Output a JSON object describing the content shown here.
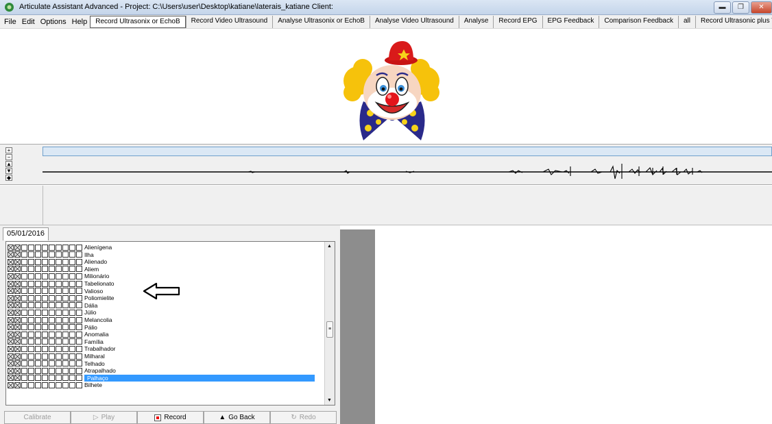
{
  "window": {
    "title": "Articulate Assistant Advanced -     Project: C:\\Users\\user\\Desktop\\katiane\\laterais_katiane     Client:",
    "controls": [
      "minimize",
      "maximize",
      "close"
    ]
  },
  "menubar": {
    "menus": [
      "File",
      "Edit",
      "Options",
      "Help"
    ],
    "tabs": [
      "Record Ultrasonix or EchoB",
      "Record Video Ultrasound",
      "Analyse Ultrasonix or EchoB",
      "Analyse Video Ultrasound",
      "Analyse",
      "Record EPG",
      "EPG Feedback",
      "Comparison Feedback",
      "all",
      "Record Ultrasonic plus Video"
    ],
    "active_tab": "Record Ultrasonix or EchoB",
    "tab_nav": "◂"
  },
  "zoom_controls": [
    "+",
    "−",
    "▲",
    "▼",
    "◆"
  ],
  "session": {
    "date_tab": "05/01/2016"
  },
  "word_list": {
    "words": [
      "Alienígena",
      "Ilha",
      "Alienado",
      "Aliem",
      "Milionário",
      "Tabelionato",
      "Valioso",
      "Poliomielite",
      "Dália",
      "Júlio",
      "Melancolia",
      "Pálio",
      "Anomalia",
      "Família",
      "Trabalhador",
      "Milharal",
      "Telhado",
      "Atrapalhado",
      "Palhaço",
      "Bilhete"
    ],
    "selected": "Palhaço",
    "scroll_thumb": "≡"
  },
  "buttons": {
    "calibrate": "Calibrate",
    "play": "Play",
    "record": "Record",
    "go_back": "Go Back",
    "redo": "Redo"
  },
  "colors": {
    "selection": "#3399ff",
    "record_dot": "#e00000",
    "grey_strip": "#8d8d8d"
  }
}
